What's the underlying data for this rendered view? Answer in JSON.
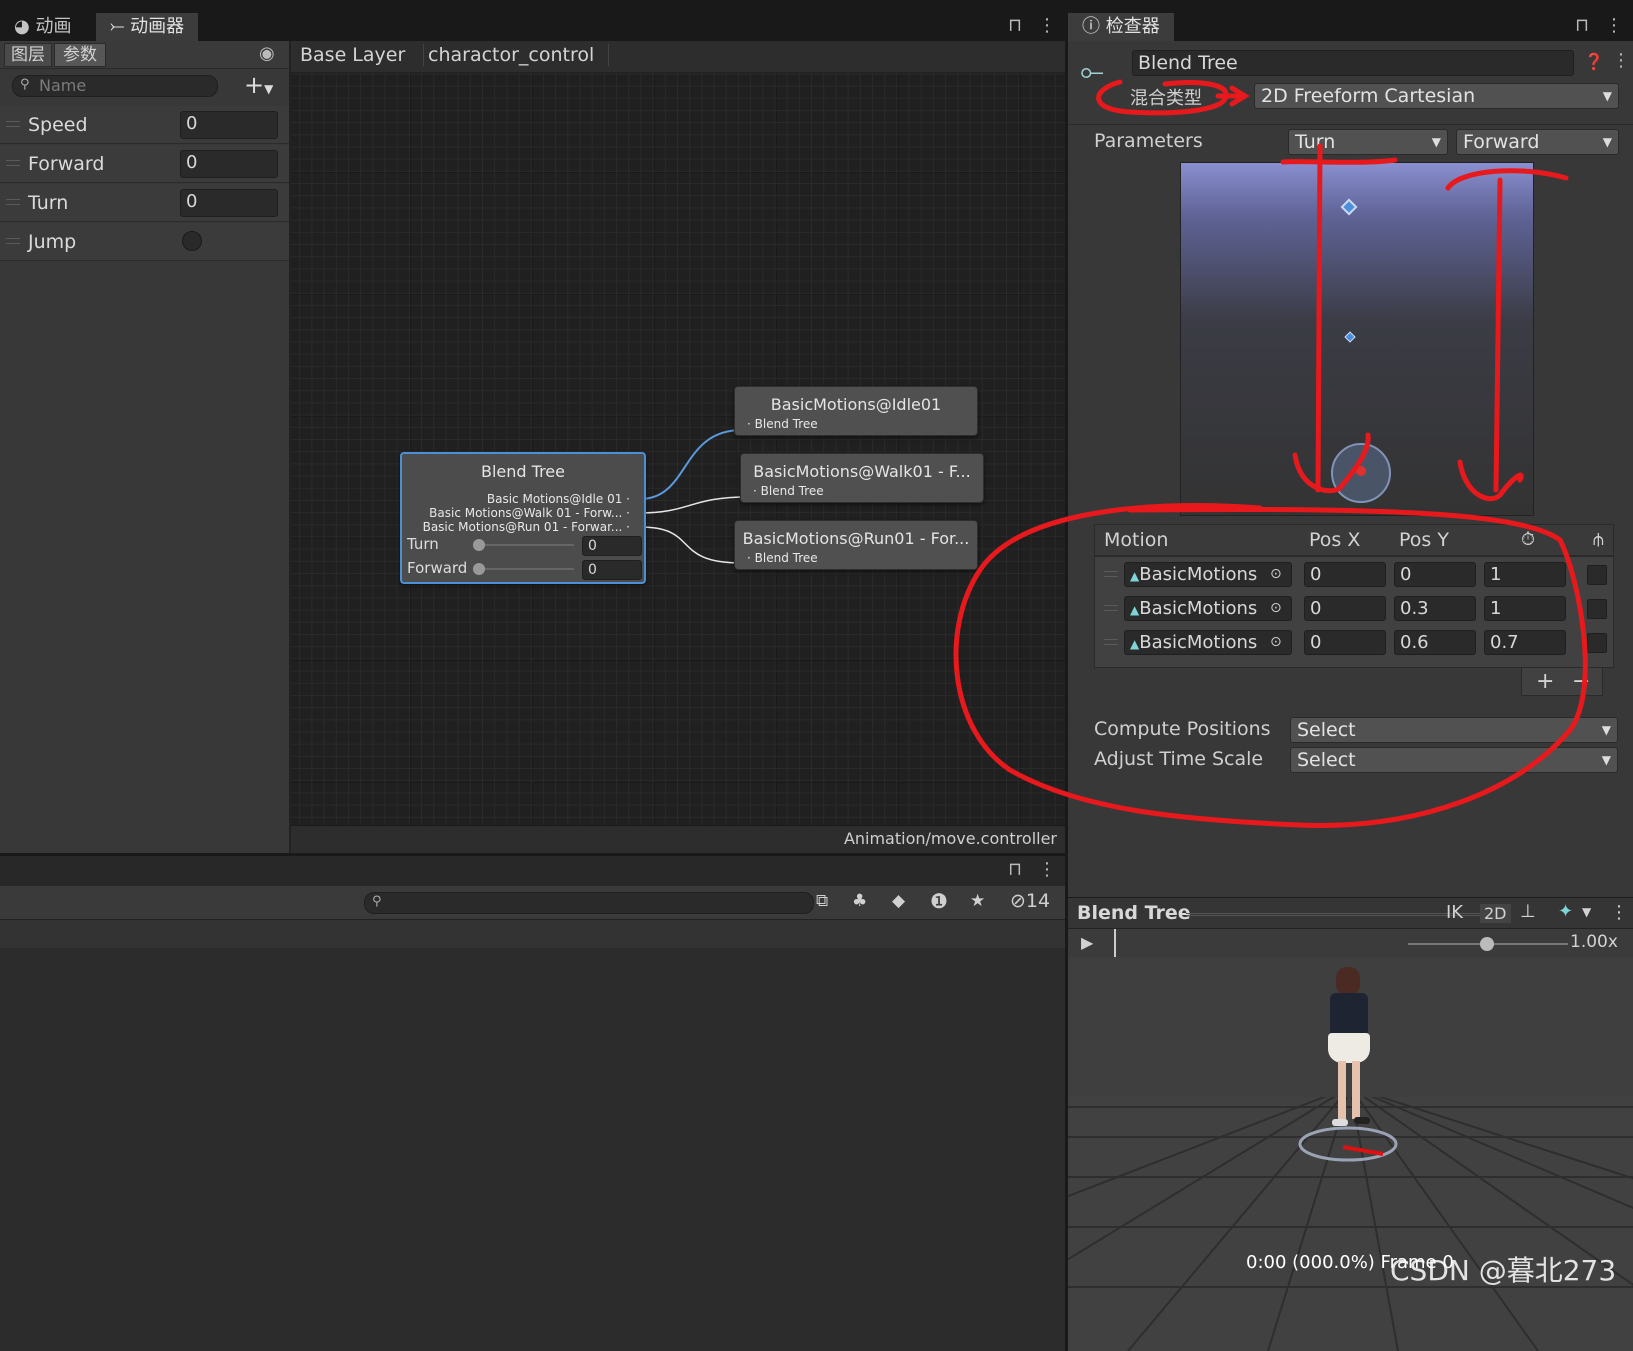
{
  "left_tabs": {
    "animation": "动画",
    "animator": "动画器"
  },
  "sub_tabs": {
    "layers": "图层",
    "params": "参数"
  },
  "search": {
    "placeholder": "Name"
  },
  "breadcrumb": [
    "Base Layer",
    "charactor_control"
  ],
  "parameters": [
    {
      "name": "Speed",
      "value": "0"
    },
    {
      "name": "Forward",
      "value": "0"
    },
    {
      "name": "Turn",
      "value": "0"
    },
    {
      "name": "Jump",
      "value": ""
    }
  ],
  "blend_node": {
    "title": "Blend Tree",
    "ports": [
      "Basic Motions@Idle 01",
      "Basic Motions@Walk 01 - Forw...",
      "Basic Motions@Run 01 - Forwar..."
    ],
    "turn_label": "Turn",
    "turn_value": "0",
    "forward_label": "Forward",
    "forward_value": "0"
  },
  "motion_nodes": [
    {
      "title": "BasicMotions@Idle01",
      "sub": "Blend Tree"
    },
    {
      "title": "BasicMotions@Walk01 - F...",
      "sub": "Blend Tree"
    },
    {
      "title": "BasicMotions@Run01 - For...",
      "sub": "Blend Tree"
    }
  ],
  "graph_footer": "Animation/move.controller",
  "console": {
    "count": "14"
  },
  "inspector": {
    "tab": "检查器",
    "name": "Blend Tree",
    "blend_type_label": "混合类型",
    "blend_type": "2D Freeform Cartesian",
    "parameters_label": "Parameters",
    "param_x": "Turn",
    "param_y": "Forward",
    "motion_header": {
      "motion": "Motion",
      "posx": "Pos X",
      "posy": "Pos Y"
    },
    "motions": [
      {
        "name": "BasicMotions",
        "posx": "0",
        "posy": "0",
        "speed": "1"
      },
      {
        "name": "BasicMotions",
        "posx": "0",
        "posy": "0.3",
        "speed": "1"
      },
      {
        "name": "BasicMotions",
        "posx": "0",
        "posy": "0.6",
        "speed": "0.7"
      }
    ],
    "compute_label": "Compute Positions",
    "compute_value": "Select",
    "adjust_label": "Adjust Time Scale",
    "adjust_value": "Select"
  },
  "preview": {
    "title": "Blend Tree",
    "ik": "IK",
    "mode": "2D",
    "speed": "1.00x",
    "time": "0:00 (000.0%) Frame 0",
    "watermark": "CSDN @暮北273"
  },
  "colors": {
    "accent": "#3d8fe0",
    "annotation": "#e8191c"
  }
}
